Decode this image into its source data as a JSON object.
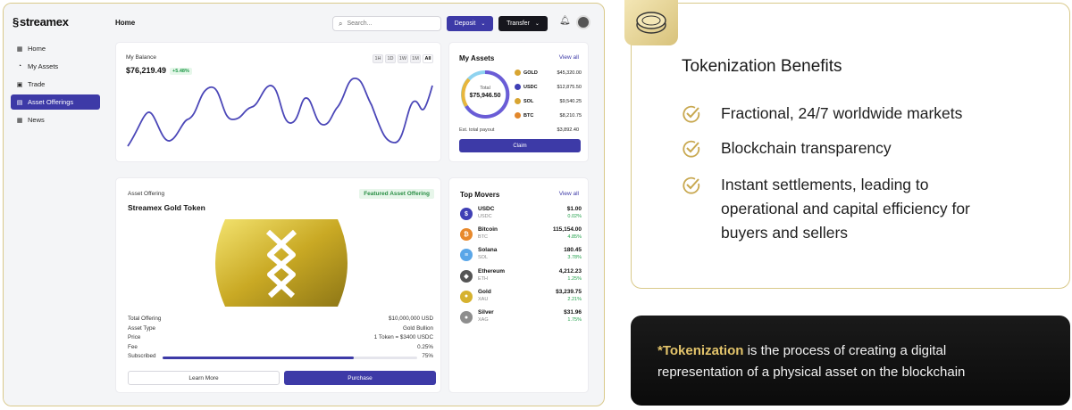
{
  "app": {
    "brand": "streamex",
    "nav": [
      {
        "label": "Home",
        "icon": "grid-icon",
        "glyph": "▦",
        "active": false
      },
      {
        "label": "My Assets",
        "icon": "wallet-icon",
        "glyph": "◔",
        "active": false
      },
      {
        "label": "Trade",
        "icon": "trade-icon",
        "glyph": "▣",
        "active": false
      },
      {
        "label": "Asset Offerings",
        "icon": "document-icon",
        "glyph": "▤",
        "active": true
      },
      {
        "label": "News",
        "icon": "news-icon",
        "glyph": "▦",
        "active": false
      }
    ],
    "page_title": "Home",
    "search_placeholder": "Search...",
    "deposit_label": "Deposit",
    "transfer_label": "Transfer"
  },
  "balance": {
    "label": "My Balance",
    "value": "$76,219.49",
    "change": "+5.48%",
    "ranges": [
      "1H",
      "1D",
      "1W",
      "1M",
      "All"
    ],
    "selected_range": "All"
  },
  "assets": {
    "title": "My Assets",
    "view_all": "View all",
    "total_label": "Total",
    "total_value": "$75,946.50",
    "items": [
      {
        "name": "GOLD",
        "value": "$45,320.00",
        "color": "#d8a531"
      },
      {
        "name": "USDC",
        "value": "$12,875.50",
        "color": "#3f3fb5"
      },
      {
        "name": "SOL",
        "value": "$9,540.25",
        "color": "#d8a531"
      },
      {
        "name": "BTC",
        "value": "$8,210.75",
        "color": "#e2872b"
      }
    ],
    "payout_label": "Est. total payout",
    "payout_value": "$3,892.40",
    "claim_label": "Claim"
  },
  "offering": {
    "label": "Asset Offering",
    "name": "Streamex Gold Token",
    "badge": "Featured Asset Offering",
    "rows": [
      {
        "k": "Total Offering",
        "v": "$10,000,000 USD"
      },
      {
        "k": "Asset Type",
        "v": "Gold Bullion"
      },
      {
        "k": "Price",
        "v": "1 Token = $3400 USDC"
      },
      {
        "k": "Fee",
        "v": "0.25%"
      }
    ],
    "subscribed_label": "Subscribed",
    "subscribed_value": "75%",
    "subscribed_fraction": 0.75,
    "learn_more": "Learn More",
    "purchase": "Purchase"
  },
  "movers": {
    "title": "Top Movers",
    "view_all": "View all",
    "items": [
      {
        "name": "USDC",
        "symbol": "USDC",
        "price": "$1.00",
        "change": "0.02%",
        "color": "#3f3fb5"
      },
      {
        "name": "Bitcoin",
        "symbol": "BTC",
        "price": "115,154.00",
        "change": "4.85%",
        "color": "#e8892c"
      },
      {
        "name": "Solana",
        "symbol": "SOL",
        "price": "180.45",
        "change": "3.78%",
        "color": "#5aa6e8"
      },
      {
        "name": "Ethereum",
        "symbol": "ETH",
        "price": "4,212.23",
        "change": "1.25%",
        "color": "#555555"
      },
      {
        "name": "Gold",
        "symbol": "XAU",
        "price": "$3,239.75",
        "change": "2.21%",
        "color": "#d6b22f"
      },
      {
        "name": "Silver",
        "symbol": "XAG",
        "price": "$31.96",
        "change": "1.75%",
        "color": "#8e8e8e"
      }
    ]
  },
  "benefits": {
    "title": "Tokenization Benefits",
    "items": [
      {
        "lines": [
          "Fractional, 24/7 worldwide markets"
        ]
      },
      {
        "lines": [
          "Blockchain transparency"
        ]
      },
      {
        "lines": [
          "Instant settlements, leading to",
          "operational and capital efficiency for",
          "buyers and sellers"
        ]
      }
    ]
  },
  "note": {
    "highlight": "*Tokenization",
    "line1_rest": " is the process of creating a digital",
    "line2": "representation of a physical asset on the blockchain"
  },
  "colors": {
    "accent": "#3d3aa7",
    "gold": "#d9c98a",
    "positive": "#22a04b"
  }
}
